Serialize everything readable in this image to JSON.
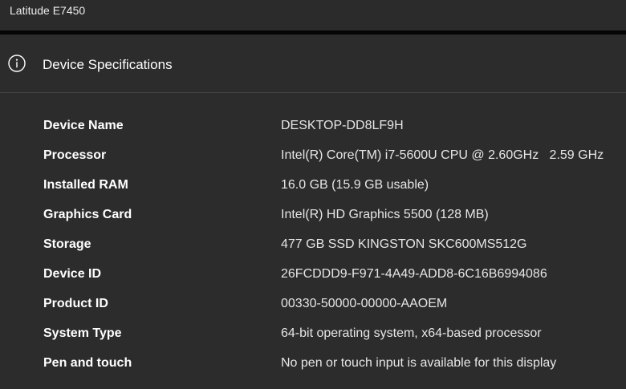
{
  "window": {
    "title": "Latitude E7450"
  },
  "section": {
    "title": "Device Specifications",
    "icon": "info-icon"
  },
  "specs": [
    {
      "label": "Device Name",
      "value": "DESKTOP-DD8LF9H"
    },
    {
      "label": "Processor",
      "value": "Intel(R) Core(TM) i7-5600U CPU @ 2.60GHz   2.59 GHz"
    },
    {
      "label": "Installed RAM",
      "value": "16.0 GB (15.9 GB usable)"
    },
    {
      "label": "Graphics Card",
      "value": "Intel(R) HD Graphics 5500 (128 MB)"
    },
    {
      "label": "Storage",
      "value": "477 GB SSD KINGSTON SKC600MS512G"
    },
    {
      "label": "Device ID",
      "value": "26FCDDD9-F971-4A49-ADD8-6C16B6994086"
    },
    {
      "label": "Product ID",
      "value": "00330-50000-00000-AAOEM"
    },
    {
      "label": "System Type",
      "value": "64-bit operating system, x64-based processor"
    },
    {
      "label": "Pen and touch",
      "value": "No pen or touch input is available for this display"
    }
  ],
  "colors": {
    "background": "#2c2c2c",
    "topbar": "#2b2b2b",
    "separator": "#050505",
    "text": "#ffffff"
  }
}
